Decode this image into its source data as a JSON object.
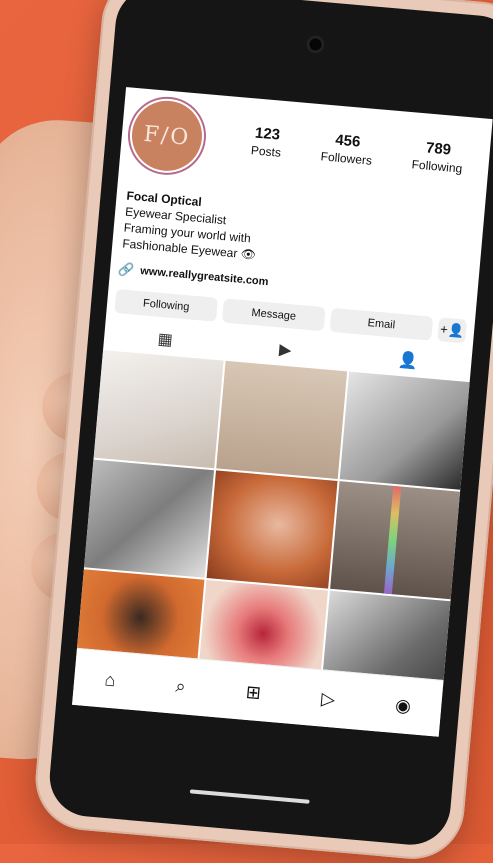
{
  "profile": {
    "avatar_text": "F/O",
    "stats": [
      {
        "value": "123",
        "label": "Posts"
      },
      {
        "value": "456",
        "label": "Followers"
      },
      {
        "value": "789",
        "label": "Following"
      }
    ],
    "name": "Focal Optical",
    "bio_lines": [
      "Eyewear Specialist",
      "Framing your world with",
      "Fashionable Eyewear 👁"
    ],
    "link": "www.reallygreatsite.com"
  },
  "actions": {
    "following": "Following",
    "message": "Message",
    "email": "Email",
    "add_user_icon": "+👤"
  },
  "tabs": {
    "grid_icon": "▦",
    "reels_icon": "▶",
    "tagged_icon": "👤"
  },
  "nav": {
    "home_icon": "⌂",
    "search_icon": "⌕",
    "new_post_icon": "⊞",
    "reels_icon": "▷",
    "profile_icon": "◉"
  }
}
